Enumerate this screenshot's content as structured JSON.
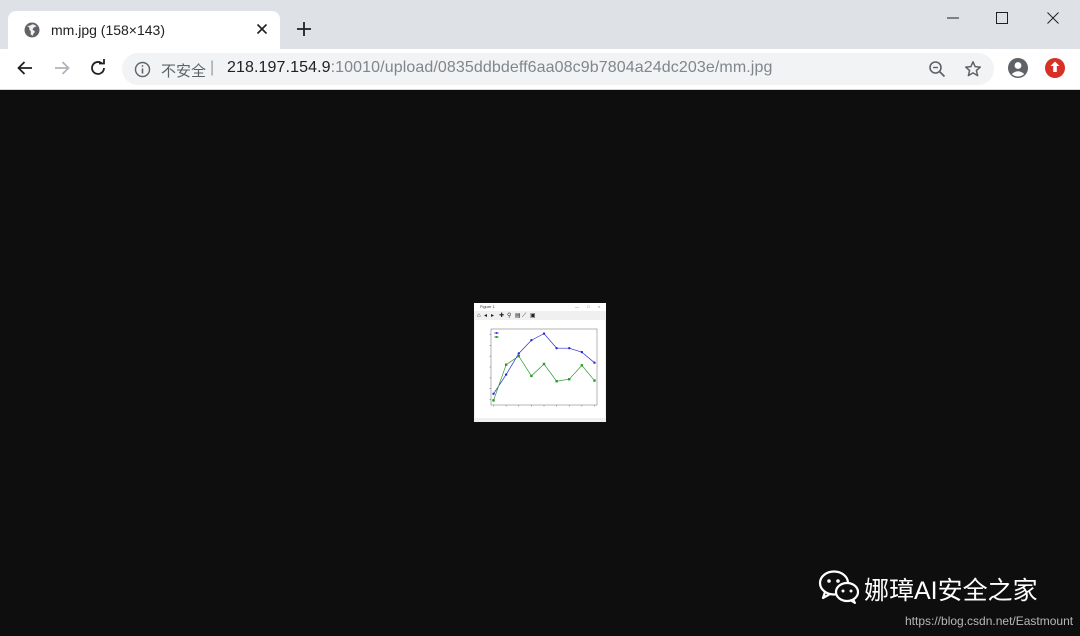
{
  "tab": {
    "title": "mm.jpg (158×143)"
  },
  "address_bar": {
    "security_label": "不安全",
    "separator": "|",
    "url_host": "218.197.154.9",
    "url_rest": ":10010/upload/0835ddbdeff6aa08c9b7804a24dc203e/mm.jpg"
  },
  "icons": {
    "favicon": "globe-icon",
    "tab_close": "close-icon",
    "new_tab": "plus-icon",
    "minimize": "minimize-icon",
    "maximize": "maximize-icon",
    "close_window": "close-icon",
    "back": "arrow-left-icon",
    "forward": "arrow-right-icon",
    "reload": "reload-icon",
    "site_info": "info-icon",
    "zoom": "zoom-out-icon",
    "bookmark": "star-icon",
    "profile": "account-icon",
    "extension": "extension-icon"
  },
  "image_window": {
    "title": "Figure 1"
  },
  "chart_data": {
    "type": "line",
    "x": [
      1,
      2,
      3,
      4,
      5,
      6,
      7,
      8,
      9
    ],
    "series": [
      {
        "values": [
          0.882,
          0.911,
          0.943,
          0.963,
          0.973,
          0.951,
          0.951,
          0.945,
          0.929
        ],
        "color": "#2a2ad6",
        "marker": "circle"
      },
      {
        "values": [
          0.872,
          0.926,
          0.939,
          0.909,
          0.927,
          0.901,
          0.904,
          0.925,
          0.902
        ],
        "color": "#2a9a2a",
        "marker": "square"
      }
    ],
    "ylim": [
      0.865,
      0.98
    ],
    "grid": false,
    "legend": "top-left"
  },
  "colors": {
    "tabstrip": "#dee1e6",
    "viewer_bg": "#0e0e0e",
    "series_blue": "#2a2ad6",
    "series_green": "#2a9a2a"
  },
  "watermark": {
    "name": "娜璋AI安全之家",
    "url": "https://blog.csdn.net/Eastmount"
  }
}
